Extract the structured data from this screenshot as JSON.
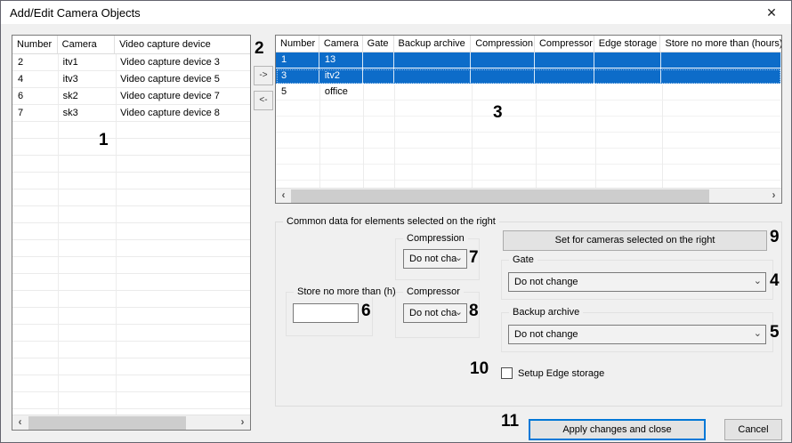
{
  "window": {
    "title": "Add/Edit Camera Objects"
  },
  "icons": {
    "close": "✕",
    "scroll_left": "‹",
    "scroll_right": "›",
    "combo_chevron": "⌄",
    "move_right": "->",
    "move_left": "<-"
  },
  "left_table": {
    "columns": [
      "Number",
      "Camera",
      "Video capture device"
    ],
    "rows": [
      [
        "2",
        "itv1",
        "Video capture device 3"
      ],
      [
        "4",
        "itv3",
        "Video capture device 5"
      ],
      [
        "6",
        "sk2",
        "Video capture device 7"
      ],
      [
        "7",
        "sk3",
        "Video capture device 8"
      ]
    ]
  },
  "right_table": {
    "columns": [
      "Number",
      "Camera",
      "Gate",
      "Backup archive",
      "Compression",
      "Compressor",
      "Edge storage",
      "Store no more than (hours)"
    ],
    "rows": [
      {
        "number": "1",
        "camera": "13",
        "selected": true
      },
      {
        "number": "3",
        "camera": "itv2",
        "selected": true
      },
      {
        "number": "5",
        "camera": "office",
        "selected": false
      }
    ]
  },
  "common": {
    "group_title": "Common data for elements selected on the right",
    "compression_label": "Compression",
    "compression_value": "Do not cha",
    "compressor_label": "Compressor",
    "compressor_value": "Do not cha",
    "store_label": "Store no more than (h)",
    "store_value": "",
    "set_button": "Set for cameras selected on the right",
    "gate_label": "Gate",
    "gate_value": "Do not change",
    "backup_label": "Backup archive",
    "backup_value": "Do not change",
    "edge_checkbox_label": "Setup Edge storage",
    "edge_checkbox_checked": false
  },
  "footer": {
    "apply": "Apply changes and close",
    "cancel": "Cancel"
  },
  "annotations": {
    "n1": "1",
    "n2": "2",
    "n3": "3",
    "n4": "4",
    "n5": "5",
    "n6": "6",
    "n7": "7",
    "n8": "8",
    "n9": "9",
    "n10": "10",
    "n11": "11"
  },
  "colors": {
    "selection_blue": "#0d6cc9",
    "focus_blue": "#0078d7",
    "dialog_bg": "#f0f0f0"
  }
}
